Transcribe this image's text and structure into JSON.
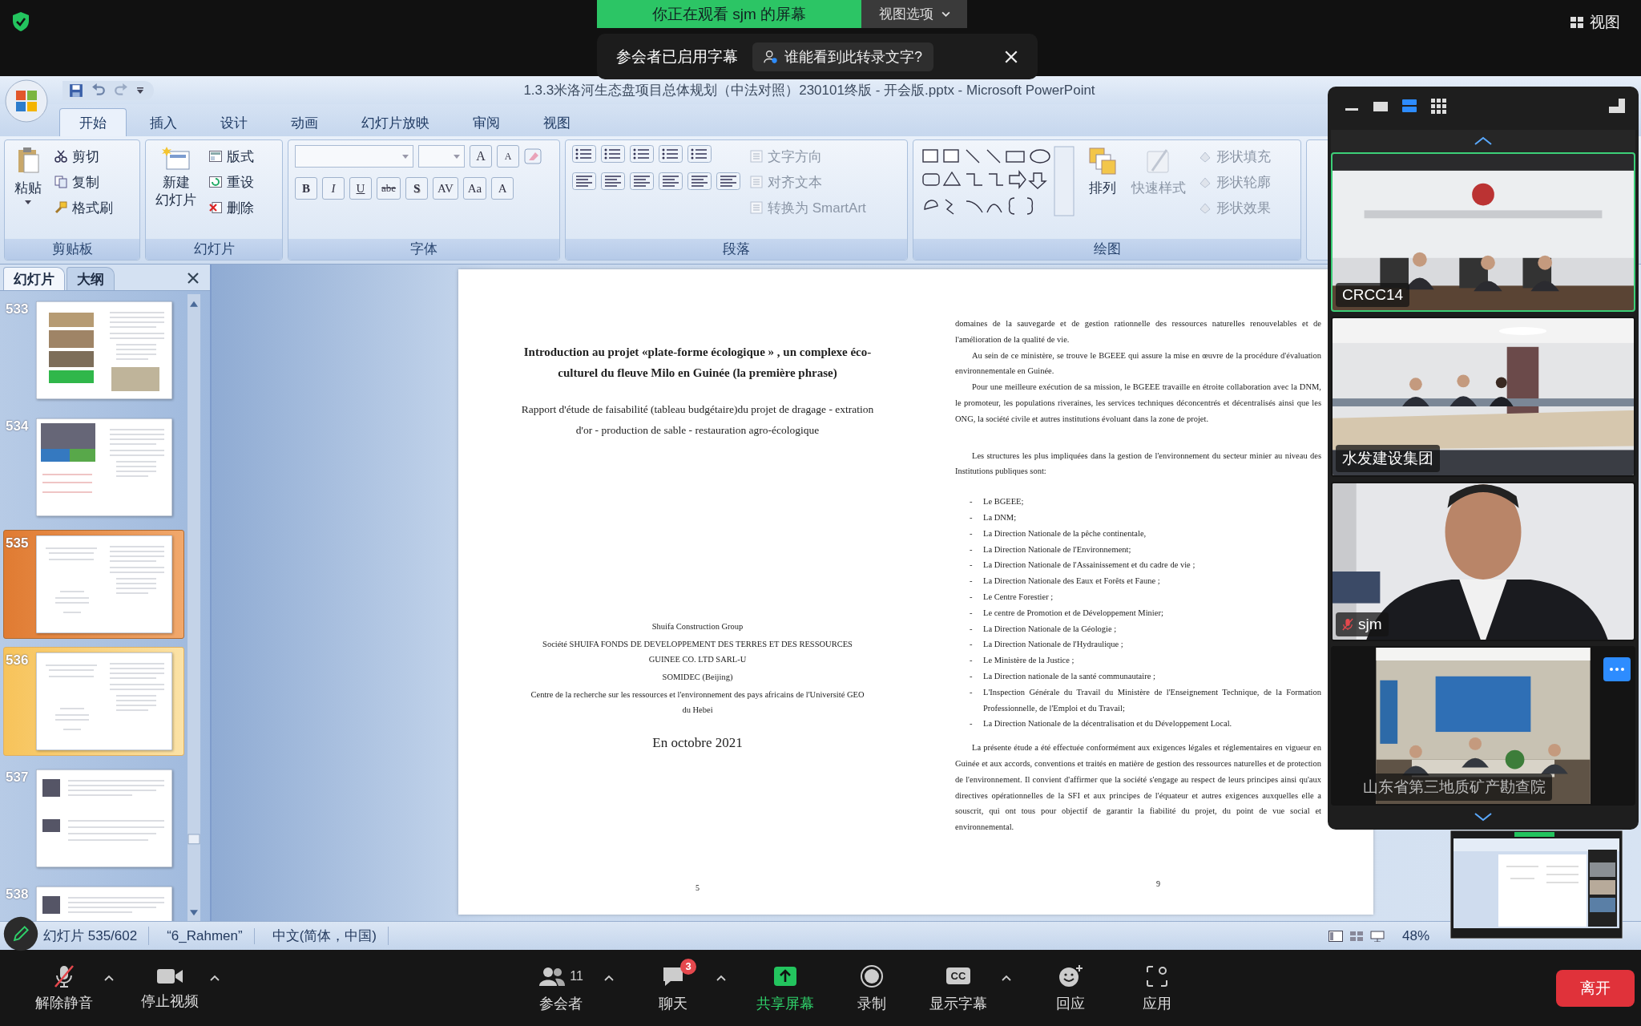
{
  "meeting_bar": {
    "viewing_banner": "你正在观看 sjm 的屏幕",
    "view_options": "视图选项",
    "view_button": "视图"
  },
  "caption_notice": {
    "text": "参会者已启用字幕",
    "who_button": "谁能看到此转录文字?"
  },
  "powerpoint": {
    "title": "1.3.3米洛河生态盘项目总体规划（中法对照）230101终版 - 开会版.pptx - Microsoft PowerPoint",
    "tabs": [
      {
        "label": "开始",
        "selected": true
      },
      {
        "label": "插入",
        "selected": false
      },
      {
        "label": "设计",
        "selected": false
      },
      {
        "label": "动画",
        "selected": false
      },
      {
        "label": "幻灯片放映",
        "selected": false
      },
      {
        "label": "审阅",
        "selected": false
      },
      {
        "label": "视图",
        "selected": false
      }
    ],
    "ribbon": {
      "clipboard": {
        "title": "剪贴板",
        "paste": "粘贴",
        "items": [
          "剪切",
          "复制",
          "格式刷"
        ]
      },
      "slides": {
        "title": "幻灯片",
        "new_slide": [
          "新建",
          "幻灯片"
        ],
        "items": [
          "版式",
          "重设",
          "删除"
        ]
      },
      "font": {
        "title": "字体",
        "grow_shrink": [
          "A",
          "A"
        ],
        "buttons": [
          "B",
          "I",
          "U",
          "abe",
          "S",
          "AV",
          "Aa",
          "A"
        ]
      },
      "paragraph": {
        "title": "段落",
        "items": [
          {
            "label": "文字方向",
            "disabled": true
          },
          {
            "label": "对齐文本",
            "disabled": true
          },
          {
            "label": "转换为 SmartArt",
            "disabled": true
          }
        ]
      },
      "drawing": {
        "title": "绘图",
        "arrange": {
          "label": "排列",
          "disabled": false
        },
        "quick_styles": {
          "label": "快速样式",
          "disabled": true
        },
        "items": [
          {
            "label": "形状填充",
            "disabled": true
          },
          {
            "label": "形状轮廓",
            "disabled": true
          },
          {
            "label": "形状效果",
            "disabled": true
          }
        ]
      }
    },
    "pane_tabs": [
      {
        "label": "幻灯片",
        "selected": true
      },
      {
        "label": "大纲",
        "selected": false
      }
    ],
    "thumbnails": [
      {
        "number": "533",
        "selected": false,
        "hovered": false
      },
      {
        "number": "534",
        "selected": false,
        "hovered": false
      },
      {
        "number": "535",
        "selected": true,
        "hovered": false
      },
      {
        "number": "536",
        "selected": false,
        "hovered": true
      },
      {
        "number": "537",
        "selected": false,
        "hovered": false
      },
      {
        "number": "538",
        "selected": false,
        "hovered": false
      }
    ],
    "slide": {
      "left_page": {
        "title": "Introduction au projet «plate-forme écologique » , un complexe éco-culturel du fleuve Milo en Guinée (la première phrase)",
        "subtitle": "Rapport d'étude de faisabilité (tableau budgétaire)du projet de dragage - extration d'or - production de sable - restauration agro-écologique",
        "organizations": [
          "Shuifa Construction Group",
          "Société SHUIFA FONDS DE DEVELOPPEMENT DES TERRES ET DES RESSOURCES GUINEE CO. LTD SARL-U",
          "SOMIDEC  (Beijing)",
          "Centre de la recherche sur les ressources et l'environnement des pays africains de l'Université GEO du Hebei"
        ],
        "date": "En octobre 2021",
        "page_number": "5"
      },
      "right_page": {
        "blocks": [
          {
            "kind": "continuation",
            "text": "domaines de la sauvegarde et de gestion rationnelle des ressources naturelles renouvelables et de l'amélioration de la qualité de vie."
          },
          {
            "kind": "paragraph",
            "text": "Au sein de ce ministère, se trouve le BGEEE qui assure la mise en œuvre de la procédure d'évaluation environnementale en Guinée."
          },
          {
            "kind": "paragraph",
            "text": "Pour une meilleure exécution de sa mission, le BGEEE travaille en étroite collaboration avec la DNM, le promoteur, les populations riveraines, les services techniques déconcentrés et décentralisés ainsi que les ONG, la société civile et autres institutions évoluant dans la zone de projet."
          },
          {
            "kind": "lead",
            "text": "Les structures les plus impliquées dans la gestion de l'environnement du secteur minier au niveau des Institutions publiques sont:"
          },
          {
            "kind": "bullet",
            "marker": "-",
            "text": "Le BGEEE;"
          },
          {
            "kind": "bullet",
            "marker": "-",
            "text": "La DNM;"
          },
          {
            "kind": "bullet",
            "marker": "-",
            "text": "La Direction Nationale de la pêche continentale,"
          },
          {
            "kind": "bullet",
            "marker": "-",
            "text": "La Direction Nationale de l'Environnement;"
          },
          {
            "kind": "bullet",
            "marker": "-",
            "text": "La Direction Nationale de l'Assainissement et du cadre de vie ;"
          },
          {
            "kind": "bullet",
            "marker": "-",
            "text": "La Direction Nationale des Eaux et Forêts et Faune ;"
          },
          {
            "kind": "bullet",
            "marker": "-",
            "text": "Le Centre Forestier ;"
          },
          {
            "kind": "bullet",
            "marker": "-",
            "text": "Le centre de Promotion et de Développement Minier;"
          },
          {
            "kind": "bullet",
            "marker": "-",
            "text": "La Direction Nationale de la Géologie ;"
          },
          {
            "kind": "bullet",
            "marker": "-",
            "text": "La Direction Nationale de l'Hydraulique ;"
          },
          {
            "kind": "bullet",
            "marker": "-",
            "text": "Le Ministère de la Justice ;"
          },
          {
            "kind": "bullet",
            "marker": "-",
            "text": "La Direction nationale de la santé communautaire ;"
          },
          {
            "kind": "bullet",
            "marker": "-",
            "text": "L'Inspection Générale du Travail du Ministère de l'Enseignement Technique, de la Formation Professionnelle, de l'Emploi et du Travail;"
          },
          {
            "kind": "bullet",
            "marker": "-",
            "text": "La Direction Nationale de la décentralisation et du Développement Local."
          },
          {
            "kind": "closing",
            "text": "La présente étude a été effectuée conformément aux exigences légales et réglementaires en vigueur en Guinée et aux accords, conventions et traités en matière de gestion des ressources naturelles et de protection de l'environnement. Il convient d'affirmer que la société s'engage au respect de leurs principes ainsi qu'aux directives opérationnelles de la SFI et aux principes de l'équateur et autres exigences auxquelles elle a souscrit, qui ont tous pour objectif de garantir la fiabilité du projet, du point de vue social et environnemental."
          }
        ],
        "page_number": "9"
      }
    },
    "status_bar": {
      "slide_counter": "幻灯片 535/602",
      "theme": "“6_Rahmen”",
      "language": "中文(简体，中国)",
      "zoom": "48%"
    }
  },
  "video_panel": {
    "tiles": [
      {
        "name": "CRCC14",
        "active_speaker": true,
        "muted": false,
        "kind": "picture"
      },
      {
        "name": "水发建设集团",
        "active_speaker": false,
        "muted": false,
        "kind": "picture"
      },
      {
        "name": "sjm",
        "active_speaker": false,
        "muted": true,
        "kind": "picture"
      },
      {
        "name": "山东省第三地质矿产勘查院",
        "active_speaker": false,
        "muted": false,
        "kind": "picture"
      }
    ]
  },
  "toolbar": {
    "items": [
      {
        "kind": "mic-off",
        "label": "解除静音",
        "menu": true,
        "highlight": false
      },
      {
        "kind": "camera",
        "label": "停止视频",
        "menu": true,
        "highlight": false
      },
      {
        "kind": "participants",
        "label": "参会者",
        "count": "11",
        "menu": true,
        "highlight": false
      },
      {
        "kind": "chat",
        "label": "聊天",
        "badge": "3",
        "menu": true,
        "highlight": false
      },
      {
        "kind": "share",
        "label": "共享屏幕",
        "menu": false,
        "highlight": true
      },
      {
        "kind": "record",
        "label": "录制",
        "menu": false,
        "highlight": false
      },
      {
        "kind": "captions",
        "label": "显示字幕",
        "icon_text": "CC",
        "menu": true,
        "highlight": false
      },
      {
        "kind": "react",
        "label": "回应",
        "menu": false,
        "highlight": false
      },
      {
        "kind": "apps",
        "label": "应用",
        "menu": false,
        "highlight": false
      }
    ],
    "leave": "离开"
  }
}
